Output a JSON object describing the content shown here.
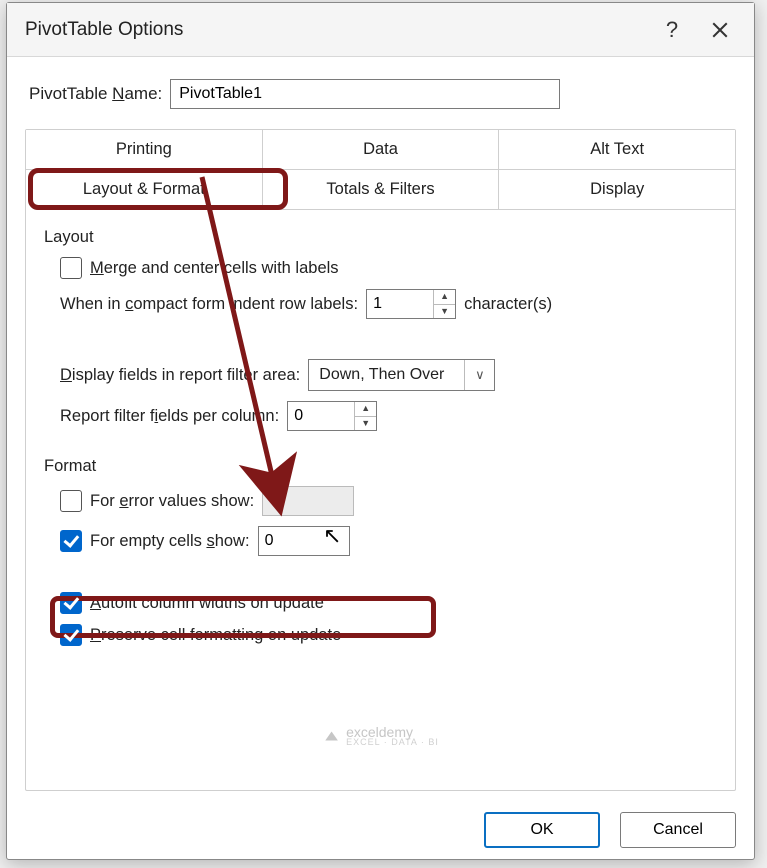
{
  "dialog": {
    "title": "PivotTable Options",
    "help_label": "?",
    "name_label_prefix": "PivotTable ",
    "name_label_underlined": "N",
    "name_label_suffix": "ame:",
    "name_value": "PivotTable1"
  },
  "tabs_row1": [
    {
      "label": "Printing"
    },
    {
      "label": "Data"
    },
    {
      "label": "Alt Text"
    }
  ],
  "tabs_row2": [
    {
      "label": "Layout & Format",
      "active": true
    },
    {
      "label": "Totals & Filters"
    },
    {
      "label": "Display"
    }
  ],
  "layout": {
    "section": "Layout",
    "merge_prefix": "M",
    "merge_text": "erge and center cells with labels",
    "merge_checked": false,
    "compact_label_1": "When in ",
    "compact_label_u": "c",
    "compact_label_2": "ompact form indent row labels:",
    "compact_value": "1",
    "compact_suffix": "character(s)",
    "display_prefix": "D",
    "display_label": "isplay fields in report filter area:",
    "display_value": "Down, Then Over",
    "filter_label_1": "Report filter f",
    "filter_label_u": "i",
    "filter_label_2": "elds per column:",
    "filter_value": "0"
  },
  "format": {
    "section": "Format",
    "error_prefix": "For ",
    "error_u": "e",
    "error_suffix": "rror values show:",
    "error_checked": false,
    "error_value": "",
    "empty_prefix": "For empty cells ",
    "empty_u": "s",
    "empty_suffix": "how:",
    "empty_checked": true,
    "empty_value": "0",
    "autofit_u": "A",
    "autofit_text": "utofit column widths on update",
    "autofit_checked": true,
    "preserve_u": "P",
    "preserve_text": "reserve cell formatting on update",
    "preserve_checked": true
  },
  "footer": {
    "ok": "OK",
    "cancel": "Cancel"
  },
  "watermark": {
    "brand": "exceldemy",
    "tag": "EXCEL · DATA · BI"
  }
}
